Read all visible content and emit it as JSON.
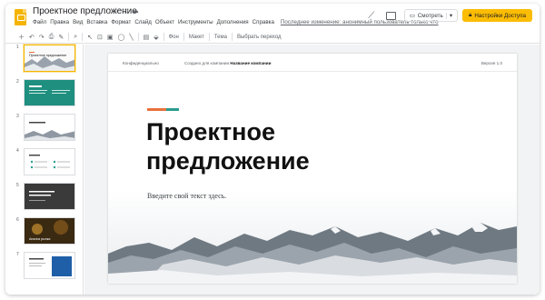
{
  "app": {
    "doc_title": "Проектное предложение",
    "last_edit": "Последнее изменение: анонимный пользователь только что",
    "menu": [
      "Файл",
      "Правка",
      "Вид",
      "Вставка",
      "Формат",
      "Слайд",
      "Объект",
      "Инструменты",
      "Дополнения",
      "Справка"
    ],
    "view_button": "Смотреть",
    "access_button": "Настройки Доступа",
    "brand_color": "#f4b400"
  },
  "toolbar": {
    "background": "Фон",
    "layout": "Макет",
    "theme": "Тема",
    "transition": "Выбрать переход"
  },
  "filmstrip": {
    "slides": [
      {
        "num": "1",
        "label": "Проектное предложение"
      },
      {
        "num": "2",
        "label": ""
      },
      {
        "num": "3",
        "label": ""
      },
      {
        "num": "4",
        "label": ""
      },
      {
        "num": "5",
        "label": ""
      },
      {
        "num": "6",
        "label": "Анализ рынка"
      },
      {
        "num": "7",
        "label": ""
      }
    ]
  },
  "slide": {
    "confidential": "Конфиденциально",
    "prepared_for": "Создано для компании",
    "company": "Название компании",
    "version": "Версия 1.0",
    "title": "Проектное\nпредложение",
    "subtitle": "Введите свой текст здесь."
  }
}
